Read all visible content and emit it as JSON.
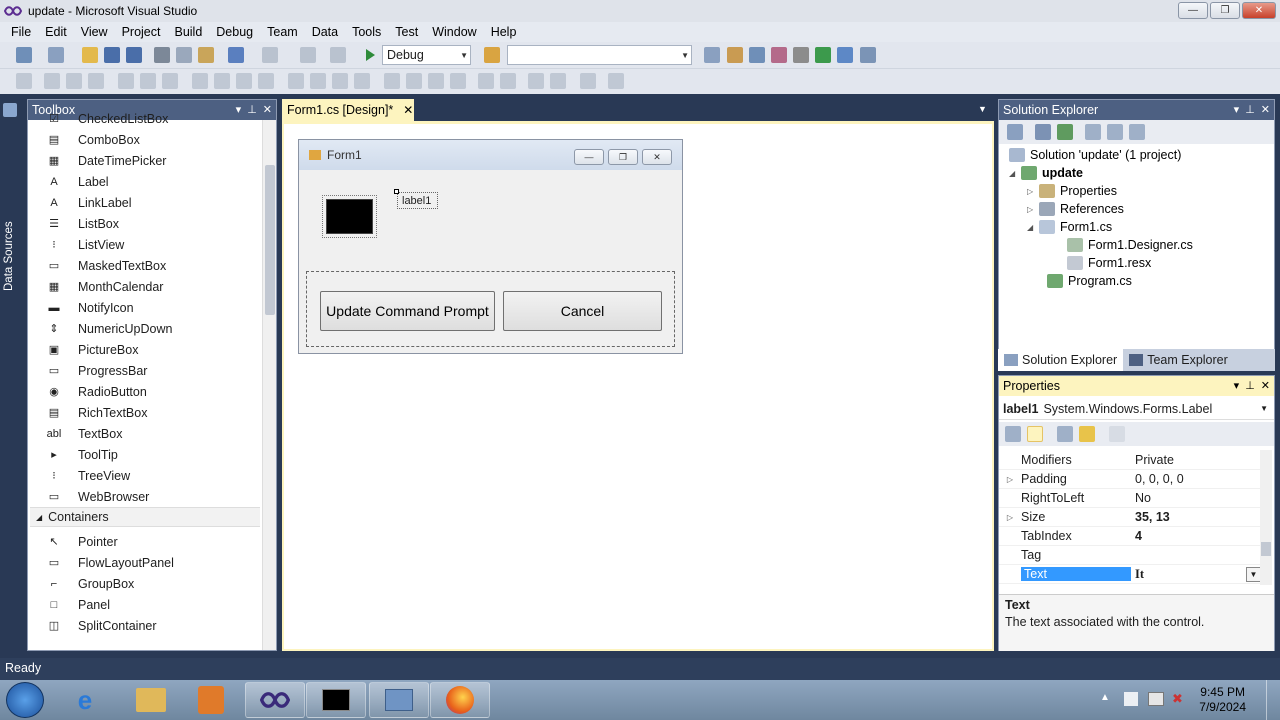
{
  "window": {
    "title": "update - Microsoft Visual Studio",
    "minimize": "—",
    "maximize": "❐",
    "close": "✕"
  },
  "menu": [
    "File",
    "Edit",
    "View",
    "Project",
    "Build",
    "Debug",
    "Team",
    "Data",
    "Tools",
    "Test",
    "Window",
    "Help"
  ],
  "toolbar": {
    "config": "Debug",
    "platform": ""
  },
  "left_strip": {
    "label": "Data Sources"
  },
  "toolbox": {
    "title": "Toolbox",
    "items": [
      {
        "label": "CheckedListBox",
        "icon": "checkedlistbox-icon",
        "glyph": "☑"
      },
      {
        "label": "ComboBox",
        "icon": "combobox-icon",
        "glyph": "▤"
      },
      {
        "label": "DateTimePicker",
        "icon": "datetimepicker-icon",
        "glyph": "▦"
      },
      {
        "label": "Label",
        "icon": "label-icon",
        "glyph": "A"
      },
      {
        "label": "LinkLabel",
        "icon": "linklabel-icon",
        "glyph": "A"
      },
      {
        "label": "ListBox",
        "icon": "listbox-icon",
        "glyph": "☰"
      },
      {
        "label": "ListView",
        "icon": "listview-icon",
        "glyph": "⁝"
      },
      {
        "label": "MaskedTextBox",
        "icon": "maskedtextbox-icon",
        "glyph": "▭"
      },
      {
        "label": "MonthCalendar",
        "icon": "monthcalendar-icon",
        "glyph": "▦"
      },
      {
        "label": "NotifyIcon",
        "icon": "notifyicon-icon",
        "glyph": "▬"
      },
      {
        "label": "NumericUpDown",
        "icon": "numericupdown-icon",
        "glyph": "⇕"
      },
      {
        "label": "PictureBox",
        "icon": "picturebox-icon",
        "glyph": "▣"
      },
      {
        "label": "ProgressBar",
        "icon": "progressbar-icon",
        "glyph": "▭"
      },
      {
        "label": "RadioButton",
        "icon": "radiobutton-icon",
        "glyph": "◉"
      },
      {
        "label": "RichTextBox",
        "icon": "richtextbox-icon",
        "glyph": "▤"
      },
      {
        "label": "TextBox",
        "icon": "textbox-icon",
        "glyph": "abl"
      },
      {
        "label": "ToolTip",
        "icon": "tooltip-icon",
        "glyph": "▸"
      },
      {
        "label": "TreeView",
        "icon": "treeview-icon",
        "glyph": "⁝"
      },
      {
        "label": "WebBrowser",
        "icon": "webbrowser-icon",
        "glyph": "▭"
      }
    ],
    "section": "Containers",
    "container_items": [
      {
        "label": "Pointer",
        "icon": "pointer-icon",
        "glyph": "↖"
      },
      {
        "label": "FlowLayoutPanel",
        "icon": "flowlayoutpanel-icon",
        "glyph": "▭"
      },
      {
        "label": "GroupBox",
        "icon": "groupbox-icon",
        "glyph": "⌐"
      },
      {
        "label": "Panel",
        "icon": "panel-icon",
        "glyph": "□"
      },
      {
        "label": "SplitContainer",
        "icon": "splitcontainer-icon",
        "glyph": "◫"
      }
    ]
  },
  "document": {
    "tab": "Form1.cs [Design]*",
    "form_title": "Form1",
    "label1": "label1",
    "update_button": "Update Command Prompt",
    "cancel_button": "Cancel"
  },
  "solution_explorer": {
    "title": "Solution Explorer",
    "solution": "Solution 'update' (1 project)",
    "project": "update",
    "properties": "Properties",
    "references": "References",
    "form1": "Form1.cs",
    "designer": "Form1.Designer.cs",
    "resx": "Form1.resx",
    "program": "Program.cs",
    "tab_solution": "Solution Explorer",
    "tab_team": "Team Explorer"
  },
  "properties": {
    "title": "Properties",
    "object_name": "label1",
    "object_type": "System.Windows.Forms.Label",
    "rows": [
      {
        "name": "Modifiers",
        "value": "Private",
        "expand": ""
      },
      {
        "name": "Padding",
        "value": "0, 0, 0, 0",
        "expand": "▷"
      },
      {
        "name": "RightToLeft",
        "value": "No",
        "expand": ""
      },
      {
        "name": "Size",
        "value": "35, 13",
        "expand": "▷"
      },
      {
        "name": "TabIndex",
        "value": "4",
        "expand": ""
      },
      {
        "name": "Tag",
        "value": "",
        "expand": ""
      },
      {
        "name": "Text",
        "value": "It",
        "expand": ""
      }
    ],
    "desc_title": "Text",
    "desc_body": "The text associated with the control."
  },
  "status": {
    "text": "Ready"
  },
  "taskbar": {
    "time": "9:45 PM",
    "date": "7/9/2024"
  },
  "colors": {
    "accent": "#fdf4bf",
    "selection": "#3399ff",
    "chrome": "#293955"
  }
}
